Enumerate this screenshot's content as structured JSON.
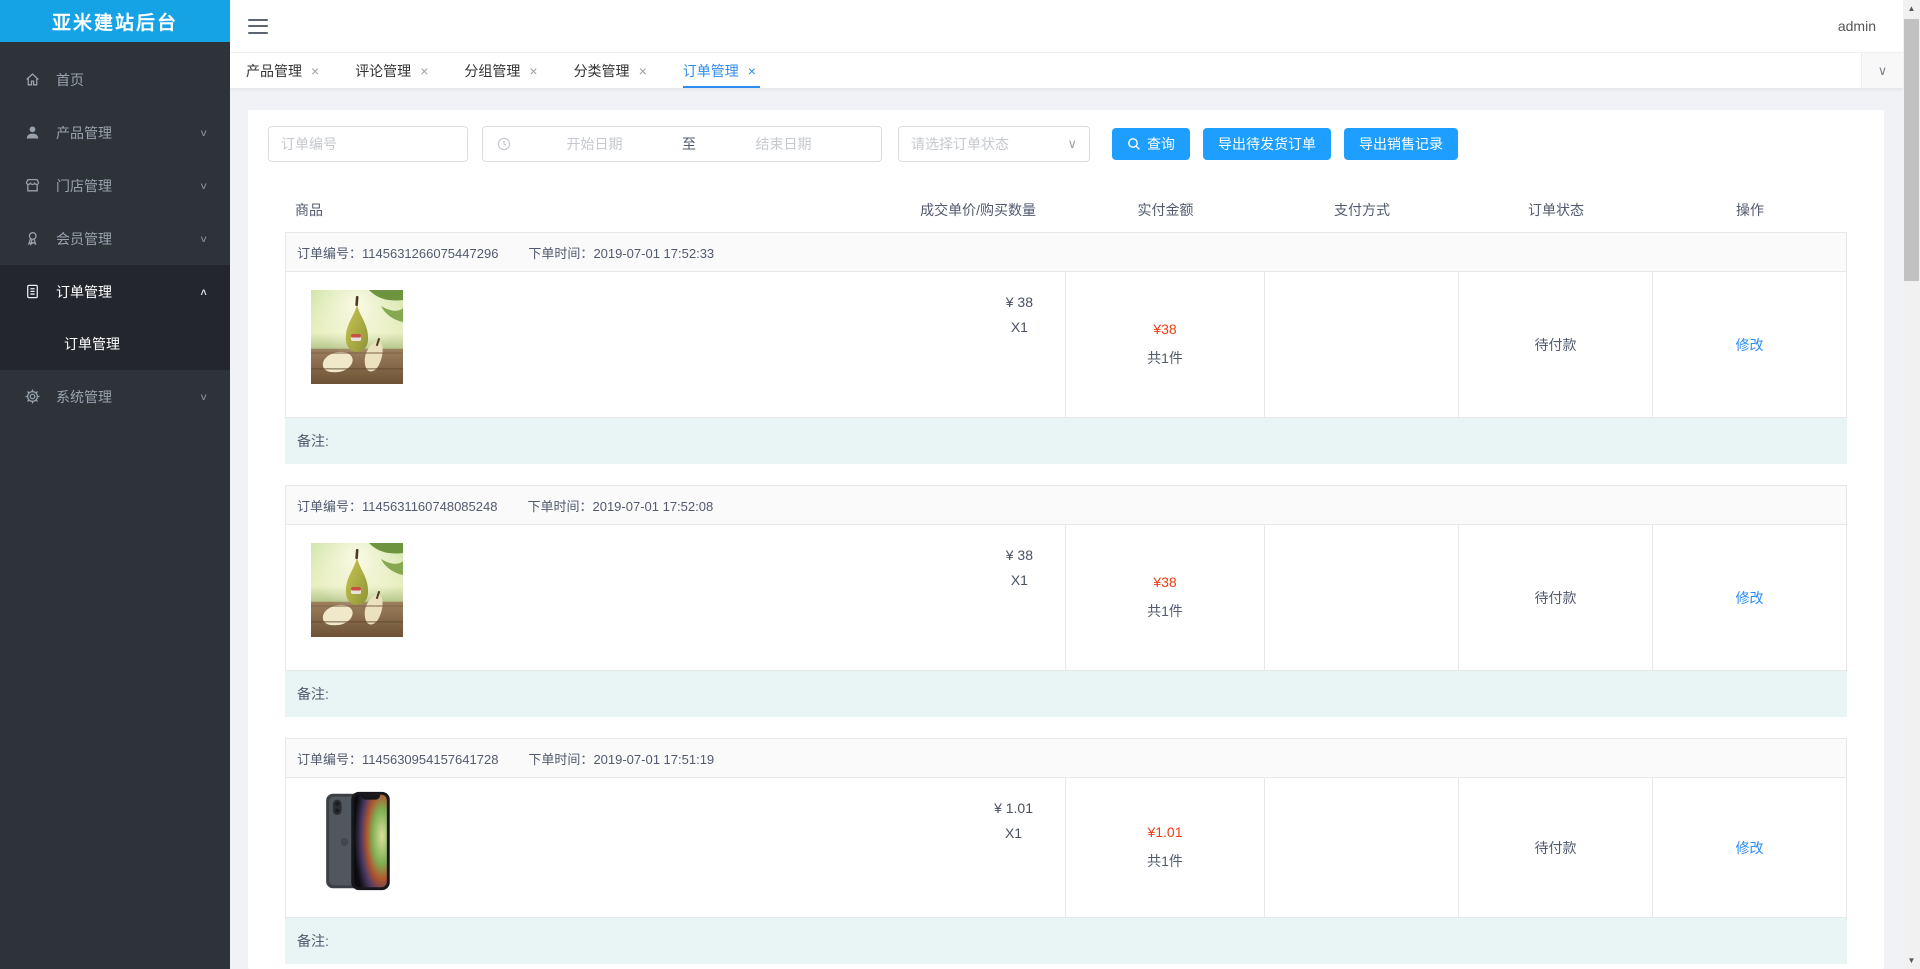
{
  "app": {
    "title": "亚米建站后台",
    "user": "admin"
  },
  "colors": {
    "logo_bg": "#16a3e6",
    "button_blue": "#1e9fff",
    "link_blue": "#2d8cf0",
    "danger_red": "#ed3f14",
    "sidebar_bg": "#2e333a",
    "remark_bg": "#e8f5f4"
  },
  "icons": {
    "chevron_down": "∨",
    "chevron_up": "∧",
    "close": "×",
    "arrow_up": "▲",
    "arrow_down": "▼"
  },
  "sidebar": {
    "items": [
      {
        "label": "首页",
        "icon": "home-icon"
      },
      {
        "label": "产品管理",
        "icon": "user-icon"
      },
      {
        "label": "门店管理",
        "icon": "shop-icon"
      },
      {
        "label": "会员管理",
        "icon": "member-badge-icon"
      },
      {
        "label": "订单管理",
        "icon": "order-doc-icon",
        "children": [
          {
            "label": "订单管理"
          }
        ]
      },
      {
        "label": "系统管理",
        "icon": "gear-icon"
      }
    ]
  },
  "tabs": {
    "items": [
      {
        "label": "产品管理"
      },
      {
        "label": "评论管理"
      },
      {
        "label": "分组管理"
      },
      {
        "label": "分类管理"
      },
      {
        "label": "订单管理"
      }
    ]
  },
  "filters": {
    "order_no_placeholder": "订单编号",
    "date_start_placeholder": "开始日期",
    "date_separator": "至",
    "date_end_placeholder": "结束日期",
    "status_placeholder": "请选择订单状态",
    "search_button": "查询",
    "export_pending_button": "导出待发货订单",
    "export_sales_button": "导出销售记录"
  },
  "table": {
    "headers": [
      "商品",
      "成交单价/购买数量",
      "实付金额",
      "支付方式",
      "订单状态",
      "操作"
    ],
    "orders": [
      {
        "order_no_label": "订单编号：",
        "order_no": "1145631266075447296",
        "time_label": "下单时间：",
        "time": "2019-07-01 17:52:33",
        "product_image": "pear-product-image",
        "unit_price": "¥ 38",
        "quantity": "X1",
        "paid_amount": "¥38",
        "total_count": "共1件",
        "payment_method": "",
        "status": "待付款",
        "action": "修改",
        "remark_label": "备注:"
      },
      {
        "order_no_label": "订单编号：",
        "order_no": "1145631160748085248",
        "time_label": "下单时间：",
        "time": "2019-07-01 17:52:08",
        "product_image": "pear-product-image",
        "unit_price": "¥ 38",
        "quantity": "X1",
        "paid_amount": "¥38",
        "total_count": "共1件",
        "payment_method": "",
        "status": "待付款",
        "action": "修改",
        "remark_label": "备注:"
      },
      {
        "order_no_label": "订单编号：",
        "order_no": "1145630954157641728",
        "time_label": "下单时间：",
        "time": "2019-07-01 17:51:19",
        "product_image": "iphone-product-image",
        "unit_price": "¥ 1.01",
        "quantity": "X1",
        "paid_amount": "¥1.01",
        "total_count": "共1件",
        "payment_method": "",
        "status": "待付款",
        "action": "修改",
        "remark_label": "备注:"
      }
    ]
  }
}
